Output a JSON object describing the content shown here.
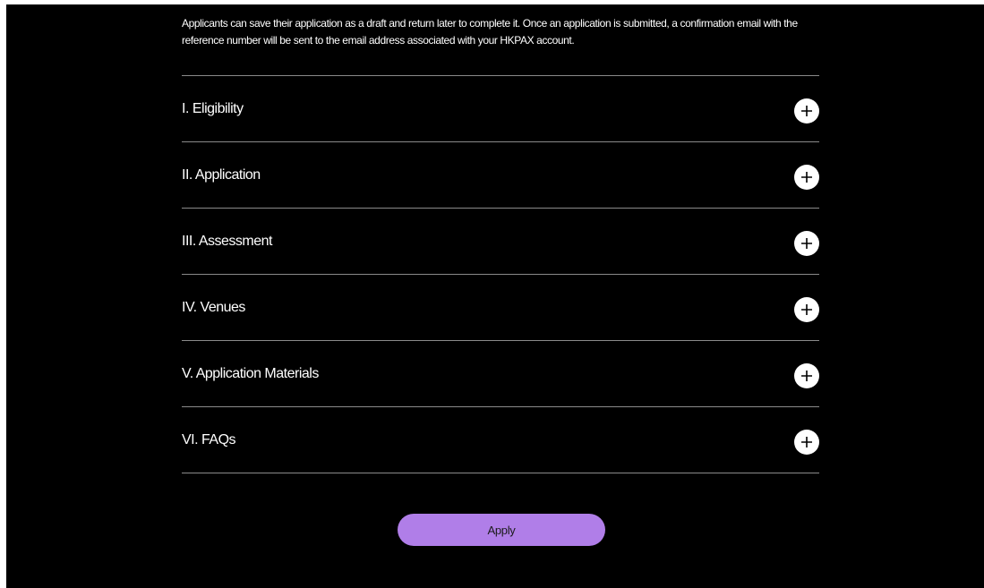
{
  "intro": {
    "text": "Applicants can save their application as a draft and return later to complete it. Once an application is submitted, a confirmation email with the reference number will be sent to the email address associated with your HKPAX account."
  },
  "accordion": {
    "items": [
      {
        "label": "I. Eligibility",
        "icon": "plus-icon"
      },
      {
        "label": "II. Application",
        "icon": "plus-icon"
      },
      {
        "label": "III. Assessment",
        "icon": "plus-icon"
      },
      {
        "label": "IV. Venues",
        "icon": "plus-icon"
      },
      {
        "label": "V. Application Materials",
        "icon": "plus-icon"
      },
      {
        "label": "VI. FAQs",
        "icon": "plus-icon"
      }
    ]
  },
  "apply_button": {
    "label": "Apply"
  },
  "colors": {
    "background": "#000000",
    "text": "#ffffff",
    "divider": "#8a8a8a",
    "accent": "#b07ee8"
  }
}
